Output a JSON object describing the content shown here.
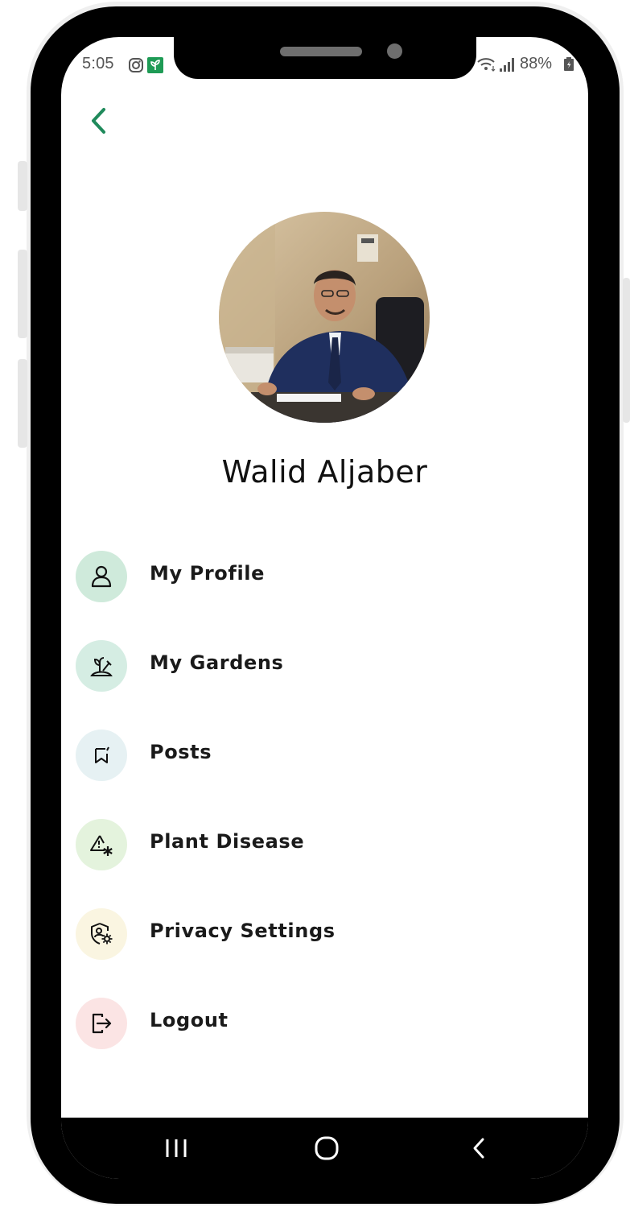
{
  "status_bar": {
    "time": "5:05",
    "battery": "88%"
  },
  "profile": {
    "name": "Walid Aljaber"
  },
  "menu": [
    {
      "label": "My Profile",
      "icon": "person-icon",
      "bg": "#cfeadb"
    },
    {
      "label": "My Gardens",
      "icon": "garden-icon",
      "bg": "#d5ede3"
    },
    {
      "label": "Posts",
      "icon": "bookmark-icon",
      "bg": "#e6f1f3"
    },
    {
      "label": "Plant Disease",
      "icon": "warning-icon",
      "bg": "#e4f3dd"
    },
    {
      "label": "Privacy Settings",
      "icon": "shield-gear-icon",
      "bg": "#faf5e1"
    },
    {
      "label": "Logout",
      "icon": "logout-icon",
      "bg": "#fbe4e4"
    }
  ],
  "colors": {
    "accent": "#1f8a5b",
    "nav_bar": "#000000"
  }
}
